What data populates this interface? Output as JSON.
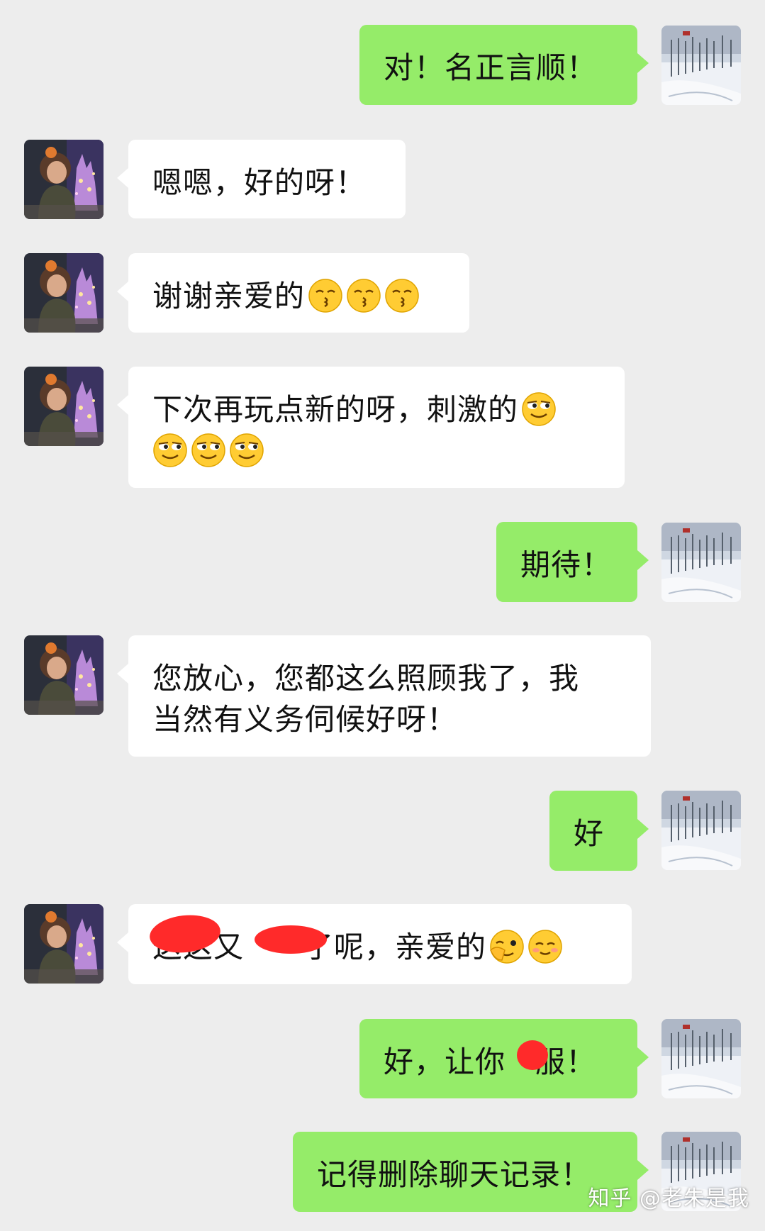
{
  "messages": [
    {
      "side": "out",
      "text": "对！名正言顺！"
    },
    {
      "side": "in",
      "text": "嗯嗯，好的呀！"
    },
    {
      "side": "in",
      "text": "谢谢亲爱的",
      "emojis": [
        "kiss-face",
        "kiss-face",
        "kiss-face"
      ]
    },
    {
      "side": "in",
      "text": "下次再玩点新的呀，刺激的",
      "emojis": [
        "smirk-face",
        "smirk-face",
        "smirk-face",
        "smirk-face"
      ]
    },
    {
      "side": "out",
      "text": "期待！"
    },
    {
      "side": "in",
      "line1": "您放心，您都这么照顾我了，我",
      "line2": "当然有义务伺候好呀！"
    },
    {
      "side": "out",
      "text": "好"
    },
    {
      "side": "in",
      "part1": "这这又",
      "part2": "了呢，亲爱的",
      "emojis": [
        "wink-face",
        "blush-face"
      ],
      "redacted": true
    },
    {
      "side": "out",
      "part1": "好，让你",
      "part2": "服！",
      "redacted": true
    },
    {
      "side": "out",
      "text": "记得删除聊天记录！"
    }
  ],
  "watermark": "知乎 @老朱是我",
  "colors": {
    "background": "#ededed",
    "outgoing_bubble": "#95ec69",
    "incoming_bubble": "#ffffff",
    "redaction": "#ff2a2a"
  }
}
